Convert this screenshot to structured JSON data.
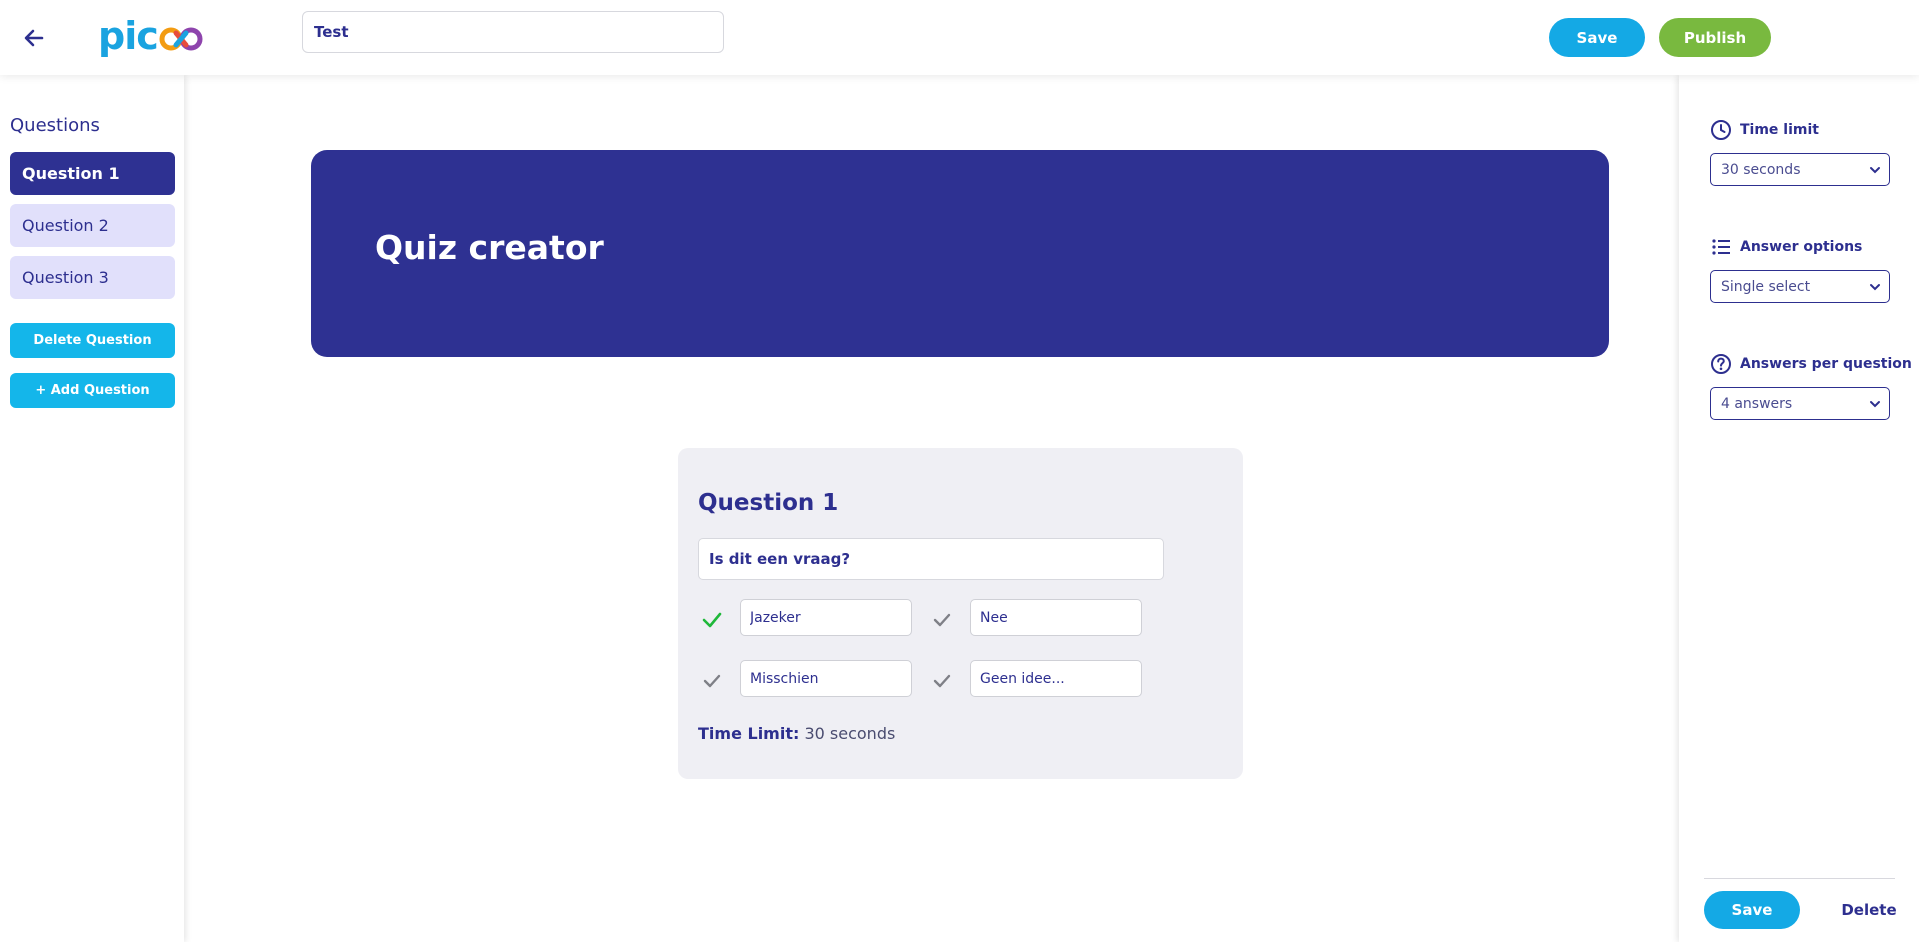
{
  "header": {
    "logo_text": "pic",
    "logo_colors": [
      "#f1c40f",
      "#e74c3c",
      "#8e44ad",
      "#1aa3e0"
    ],
    "title_value": "Test",
    "save_label": "Save",
    "publish_label": "Publish"
  },
  "sidebar": {
    "title": "Questions",
    "items": [
      {
        "label": "Question 1",
        "active": true
      },
      {
        "label": "Question 2",
        "active": false
      },
      {
        "label": "Question 3",
        "active": false
      }
    ],
    "delete_label": "Delete Question",
    "add_label": "+ Add Question"
  },
  "main": {
    "banner_title": "Quiz creator",
    "card": {
      "title": "Question 1",
      "question_value": "Is dit een vraag?",
      "answers": [
        {
          "value": "Jazeker",
          "correct": true
        },
        {
          "value": "Nee",
          "correct": false
        },
        {
          "value": "Misschien",
          "correct": false
        },
        {
          "value": "Geen idee...",
          "correct": false
        }
      ],
      "time_limit_label": "Time Limit:",
      "time_limit_value": "30 seconds"
    }
  },
  "settings": {
    "time_limit": {
      "label": "Time limit",
      "value": "30 seconds"
    },
    "answer_options": {
      "label": "Answer options",
      "value": "Single select"
    },
    "answers_per_question": {
      "label": "Answers per question",
      "value": "4 answers"
    },
    "save_label": "Save",
    "delete_label": "Delete"
  },
  "colors": {
    "primary": "#2e3192",
    "accent_blue": "#14a9e5",
    "publish_green": "#79b93f",
    "correct_check": "#1fb83a",
    "inactive_check": "#7f8087"
  }
}
